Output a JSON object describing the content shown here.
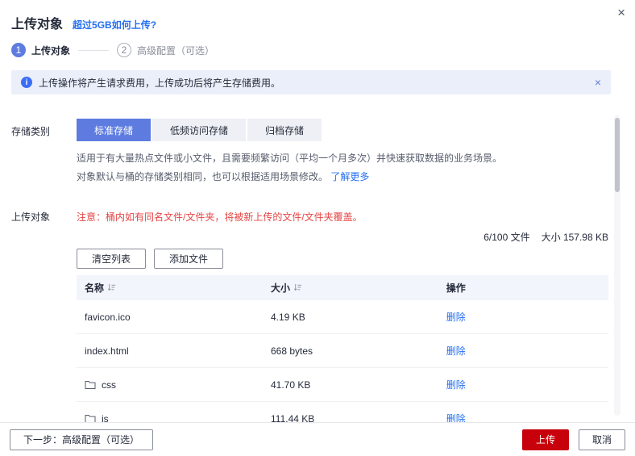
{
  "dialog": {
    "title": "上传对象",
    "help_link": "超过5GB如何上传?",
    "close": "×"
  },
  "steps": [
    {
      "number": "1",
      "label": "上传对象"
    },
    {
      "number": "2",
      "label": "高级配置（可选）"
    }
  ],
  "banner": {
    "text": "上传操作将产生请求费用，上传成功后将产生存储费用。",
    "close": "×"
  },
  "storage_class": {
    "label": "存储类别",
    "options": [
      "标准存储",
      "低频访问存储",
      "归档存储"
    ],
    "selected": "标准存储",
    "description_line1": "适用于有大量热点文件或小文件，且需要频繁访问（平均一个月多次）并快速获取数据的业务场景。",
    "description_line2": "对象默认与桶的存储类别相同，也可以根据适用场景修改。",
    "learn_more": "了解更多"
  },
  "upload_section": {
    "label": "上传对象",
    "warning": "注意：桶内如有同名文件/文件夹，将被新上传的文件/文件夹覆盖。",
    "file_count": "6/100 文件",
    "total_size": "大小 157.98 KB",
    "clear_button": "清空列表",
    "add_button": "添加文件"
  },
  "table": {
    "headers": [
      "名称",
      "大小",
      "操作"
    ],
    "rows": [
      {
        "name": "favicon.ico",
        "size": "4.19 KB",
        "action": "删除",
        "is_folder": false
      },
      {
        "name": "index.html",
        "size": "668 bytes",
        "action": "删除",
        "is_folder": false
      },
      {
        "name": "css",
        "size": "41.70 KB",
        "action": "删除",
        "is_folder": true
      },
      {
        "name": "js",
        "size": "111.44 KB",
        "action": "删除",
        "is_folder": true
      }
    ]
  },
  "footer": {
    "next_button": "下一步：高级配置（可选）",
    "upload_button": "上传",
    "cancel_button": "取消"
  },
  "colors": {
    "accent_blue": "#5e7ce0",
    "link_blue": "#256ff1",
    "warning_red": "#e64545",
    "upload_red": "#c7000b",
    "banner_bg": "#ebeffa",
    "table_header_bg": "#f2f5fc"
  }
}
